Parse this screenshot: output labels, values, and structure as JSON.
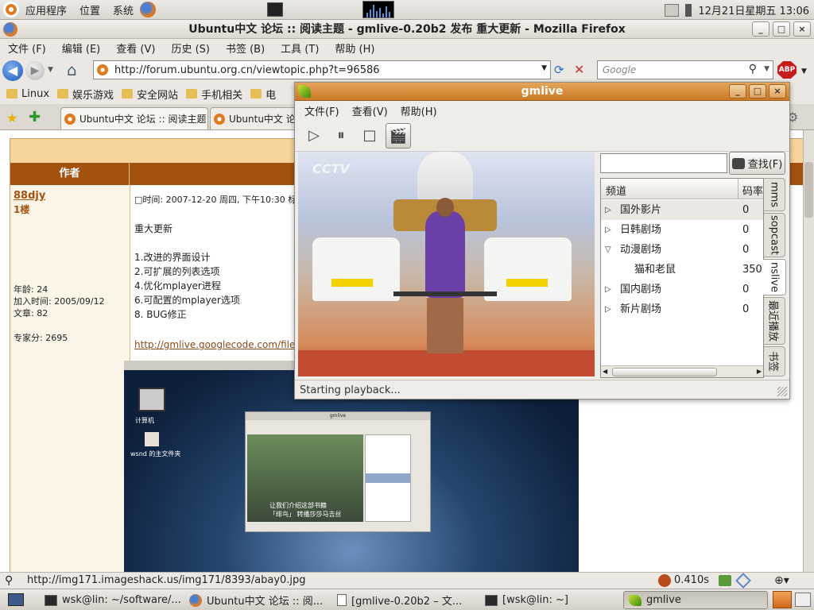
{
  "top_panel": {
    "menus": [
      "应用程序",
      "位置",
      "系统"
    ],
    "clock": "12月21日星期五 13:06"
  },
  "firefox": {
    "title": "Ubuntu中文 论坛 :: 阅读主题 - gmlive-0.20b2 发布 重大更新 - Mozilla Firefox",
    "menu": [
      "文件 (F)",
      "编辑 (E)",
      "查看 (V)",
      "历史 (S)",
      "书签 (B)",
      "工具 (T)",
      "帮助 (H)"
    ],
    "url": "http://forum.ubuntu.org.cn/viewtopic.php?t=96586",
    "search_placeholder": "Google",
    "abp_label": "ABP",
    "bookmarks": [
      "Linux",
      "娱乐游戏",
      "安全网站",
      "手机相关",
      "电"
    ],
    "tabs": [
      {
        "label": "Ubuntu中文 论坛 :: 阅读主题 ...",
        "active": true
      },
      {
        "label": "Ubuntu中文 论坛 :: 阅读主题 ...",
        "active": false
      }
    ],
    "status_url": "http://img171.imageshack.us/img171/8393/abay0.jpg",
    "status_timer": "0.410s"
  },
  "forum": {
    "author_header": "作者",
    "author": {
      "name": "88djy",
      "floor": "1楼",
      "stats": [
        "年龄: 24",
        "加入时间: 2005/09/12",
        "文章: 82"
      ],
      "expert": "专家分: 2695"
    },
    "post": {
      "meta": "□时间: 2007-12-20 周四, 下午10:30    标",
      "title": "重大更新",
      "items": [
        "1.改进的界面设计",
        "2.可扩展的列表选项",
        "4.优化mplayer进程",
        "6.可配置的mplayer选项",
        "8. BUG修正"
      ],
      "link": "http://gmlive.googlecode.com/files/g"
    },
    "screenshot": {
      "label1": "计算机",
      "label2": "wsnd 的主文件夹",
      "window_title": "gmlive",
      "subtitle": [
        "让我们介绍这部书籍",
        "「绯鸟」 转播莎莎马吉丝"
      ]
    }
  },
  "gmlive": {
    "title": "gmlive",
    "menu": [
      "文件(F)",
      "查看(V)",
      "帮助(H)"
    ],
    "find_label": "查找(F)",
    "tree_headers": {
      "name": "频道",
      "rate": "码率"
    },
    "channels": [
      {
        "name": "国外影片",
        "rate": "0",
        "expander": "collapsed",
        "level": 0,
        "selected": true
      },
      {
        "name": "日韩剧场",
        "rate": "0",
        "expander": "collapsed",
        "level": 0,
        "selected": false
      },
      {
        "name": "动漫剧场",
        "rate": "0",
        "expander": "expanded",
        "level": 0,
        "selected": false
      },
      {
        "name": "猫和老鼠",
        "rate": "350",
        "expander": "none",
        "level": 1,
        "selected": false
      },
      {
        "name": "国内剧场",
        "rate": "0",
        "expander": "collapsed",
        "level": 0,
        "selected": false
      },
      {
        "name": "新片剧场",
        "rate": "0",
        "expander": "collapsed",
        "level": 0,
        "selected": false
      }
    ],
    "side_tabs": [
      {
        "label": "mms",
        "active": false
      },
      {
        "label": "sopcast",
        "active": false
      },
      {
        "label": "nslive",
        "active": true
      },
      {
        "label": "最近播放",
        "active": false
      },
      {
        "label": "书签",
        "active": false
      }
    ],
    "status": "Starting playback...",
    "video_logo": "CCTV"
  },
  "taskbar": {
    "tasks": [
      {
        "label": "wsk@lin: ~/software/...",
        "icon": "terminal-icon"
      },
      {
        "label": "Ubuntu中文 论坛 :: 阅...",
        "icon": "firefox-icon"
      },
      {
        "label": "[gmlive-0.20b2 – 文...",
        "icon": "document-icon"
      },
      {
        "label": "[wsk@lin: ~]",
        "icon": "terminal-icon"
      },
      {
        "label": "gmlive",
        "icon": "gmlive-icon"
      }
    ]
  }
}
